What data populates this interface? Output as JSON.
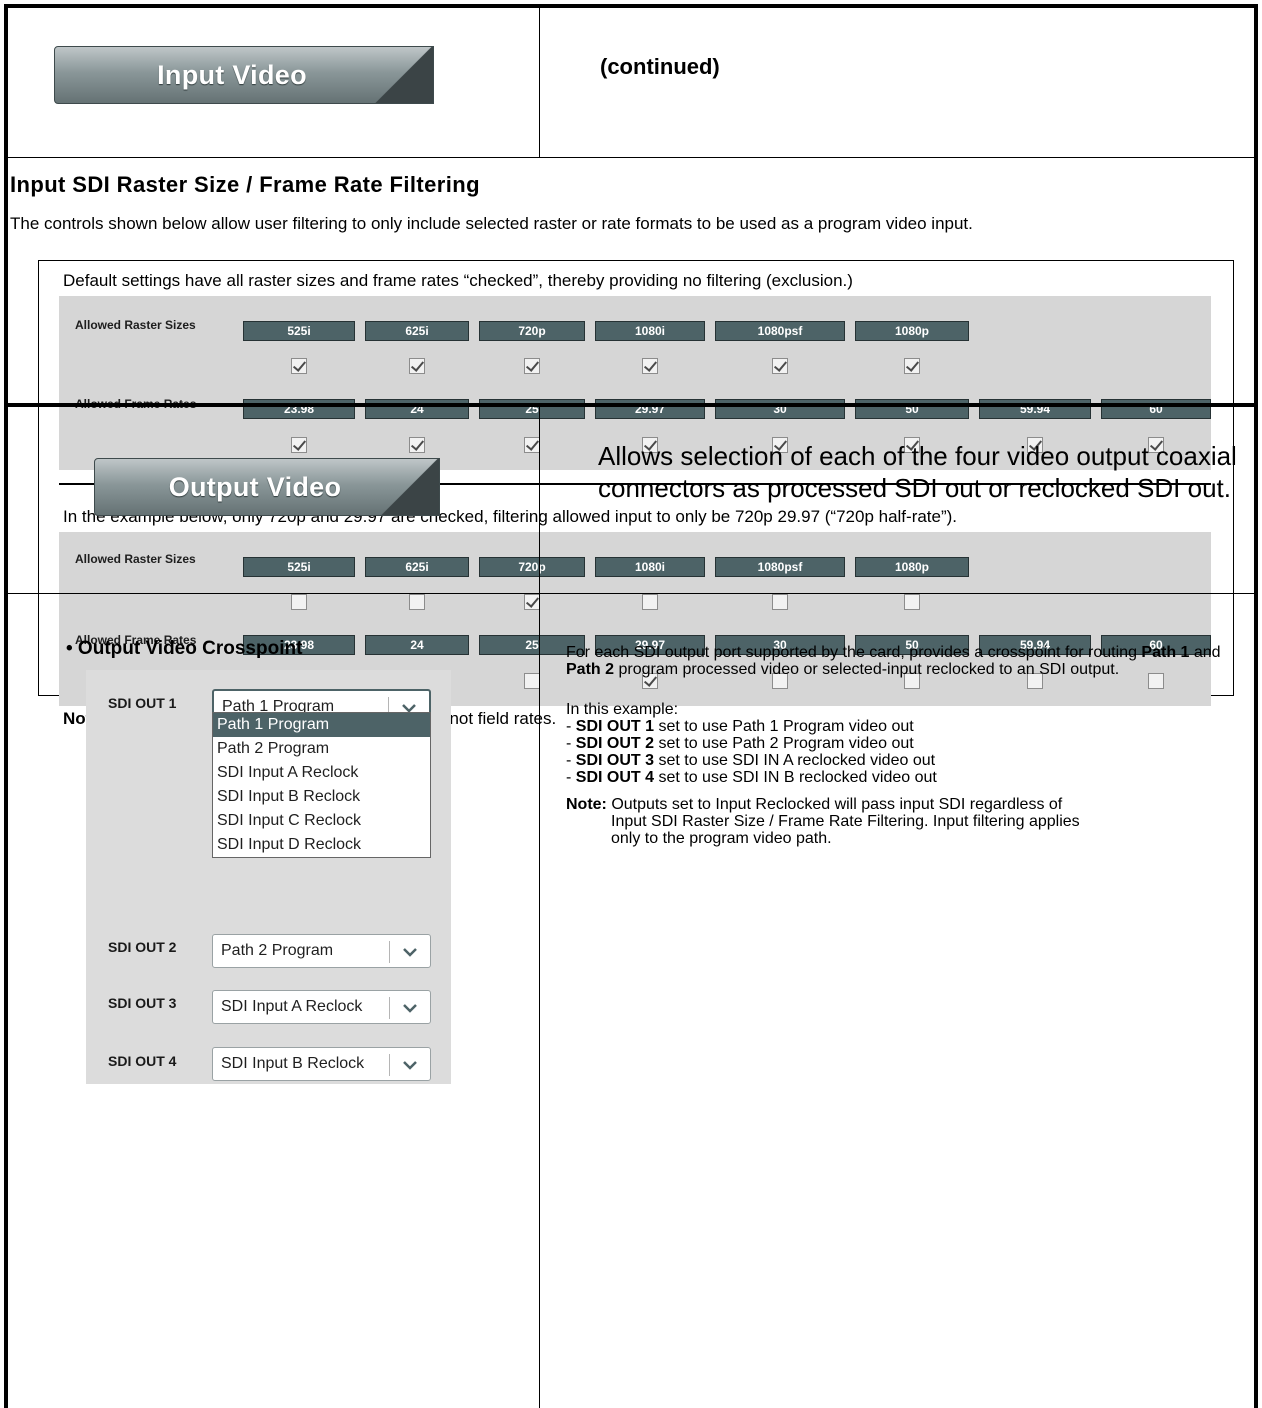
{
  "top": {
    "tab_input_video": "Input Video",
    "continued": "(continued)"
  },
  "filtering": {
    "title": "Input SDI Raster Size / Frame Rate Filtering",
    "description": "The controls shown below allow user filtering to only include selected raster or rate formats to be used as a program video input.",
    "default_text": "Default settings have all raster sizes and frame rates “checked”, thereby providing no filtering (exclusion.)",
    "example_text": "In the example below, only 720p and 29.97 are checked, filtering allowed input to only be 720p 29.97 (“720p half-rate”).",
    "raster_label": "Allowed Raster Sizes",
    "rate_label": "Allowed Frame Rates",
    "raster_sizes": [
      "525i",
      "625i",
      "720p",
      "1080i",
      "1080psf",
      "1080p"
    ],
    "frame_rates": [
      "23.98",
      "24",
      "25",
      "29.97",
      "30",
      "50",
      "59.94",
      "60"
    ],
    "default_raster_checked": [
      true,
      true,
      true,
      true,
      true,
      true
    ],
    "default_rate_checked": [
      true,
      true,
      true,
      true,
      true,
      true,
      true,
      true
    ],
    "example_raster_checked": [
      false,
      false,
      true,
      false,
      false,
      false
    ],
    "example_rate_checked": [
      false,
      false,
      false,
      true,
      false,
      false,
      false,
      false
    ],
    "note_label": "Note:",
    "note_text": " Rates shown in selector are frame rates and not field rates."
  },
  "output": {
    "tab_output_video": "Output Video",
    "allows_text": "Allows selection of each of the four video output coaxial connectors as processed SDI out or reclocked SDI out.",
    "crosspoint_title": "• Output Video Crosspoint",
    "sdi_out_1_label": "SDI OUT 1",
    "sdi_out_2_label": "SDI OUT 2",
    "sdi_out_3_label": "SDI OUT 3",
    "sdi_out_4_label": "SDI OUT 4",
    "sdi_out_1_value": "Path 1 Program",
    "sdi_out_2_value": "Path 2 Program",
    "sdi_out_3_value": "SDI Input A Reclock",
    "sdi_out_4_value": "SDI Input B Reclock",
    "dropdown_options": [
      "Path 1 Program",
      "Path 2 Program",
      "SDI Input A Reclock",
      "SDI Input B Reclock",
      "SDI Input C Reclock",
      "SDI Input D Reclock"
    ],
    "desc_p1_a": "For each SDI output port supported by the card, provides a crosspoint for routing ",
    "desc_p1_b": "Path 1",
    "desc_p1_c": " and ",
    "desc_p1_d": "Path 2",
    "desc_p1_e": " program processed video or selected-input reclocked to an SDI output.",
    "example_intro": "In this example:",
    "ex1_b": "SDI OUT 1",
    "ex1_t": " set to use Path 1 Program video out",
    "ex2_b": "SDI OUT 2",
    "ex2_t": " set to use Path 2 Program video out",
    "ex3_b": "SDI OUT 3",
    "ex3_t": " set to use SDI IN A reclocked video out",
    "ex4_b": "SDI OUT 4",
    "ex4_t": " set to use SDI IN B reclocked video out",
    "note_label": "Note:",
    "note_line1": " Outputs set to Input Reclocked will pass input SDI regardless of",
    "note_line2": "Input SDI Raster Size / Frame Rate Filtering. Input filtering applies",
    "note_line3": "only to the program video path."
  },
  "colors": {
    "chip": "#4d6367",
    "panel": "#d6d6d6",
    "dropdown_highlight": "#4d6367"
  }
}
